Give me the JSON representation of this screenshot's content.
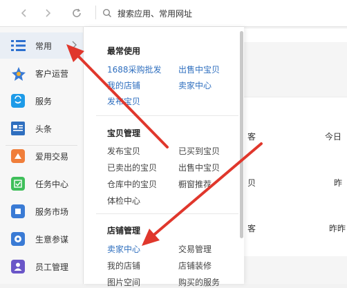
{
  "toolbar": {
    "search_placeholder": "搜索应用、常用网址"
  },
  "sidebar": {
    "items": [
      {
        "label": "常用",
        "icon": "list-icon",
        "color": "#2b6fcf"
      },
      {
        "label": "客户运营",
        "icon": "customer-ops-icon",
        "color": "#3a7bd5"
      },
      {
        "label": "服务",
        "icon": "bag-icon",
        "color": "#1e9be8"
      },
      {
        "label": "头条",
        "icon": "news-icon",
        "color": "#2f6fbf"
      },
      {
        "label": "爱用交易",
        "icon": "trade-icon",
        "color": "#f07e3a"
      },
      {
        "label": "任务中心",
        "icon": "task-icon",
        "color": "#3fbf5a"
      },
      {
        "label": "服务市场",
        "icon": "market-icon",
        "color": "#3a7bd5"
      },
      {
        "label": "生意参谋",
        "icon": "advisor-icon",
        "color": "#3a7bd5"
      },
      {
        "label": "员工管理",
        "icon": "staff-icon",
        "color": "#6a56c8"
      }
    ]
  },
  "panel": {
    "sections": [
      {
        "title": "最常使用",
        "links": [
          "1688采购批发",
          "出售中宝贝",
          "我的店铺",
          "卖家中心",
          "发布宝贝"
        ]
      },
      {
        "title": "宝贝管理",
        "links": [
          "发布宝贝",
          "已买到宝贝",
          "已卖出的宝贝",
          "出售中宝贝",
          "仓库中的宝贝",
          "橱窗推荐",
          "体检中心"
        ]
      },
      {
        "title": "店铺管理",
        "links": [
          "卖家中心",
          "交易管理",
          "我的店铺",
          "店铺装修",
          "图片空间",
          "购买的服务"
        ]
      }
    ]
  },
  "background": {
    "texts": [
      "客",
      "今日",
      "贝",
      "昨",
      "客",
      "昨昨"
    ]
  },
  "colors": {
    "accent_blue": "#2f6fbf",
    "arrow_red": "#e0372c"
  }
}
